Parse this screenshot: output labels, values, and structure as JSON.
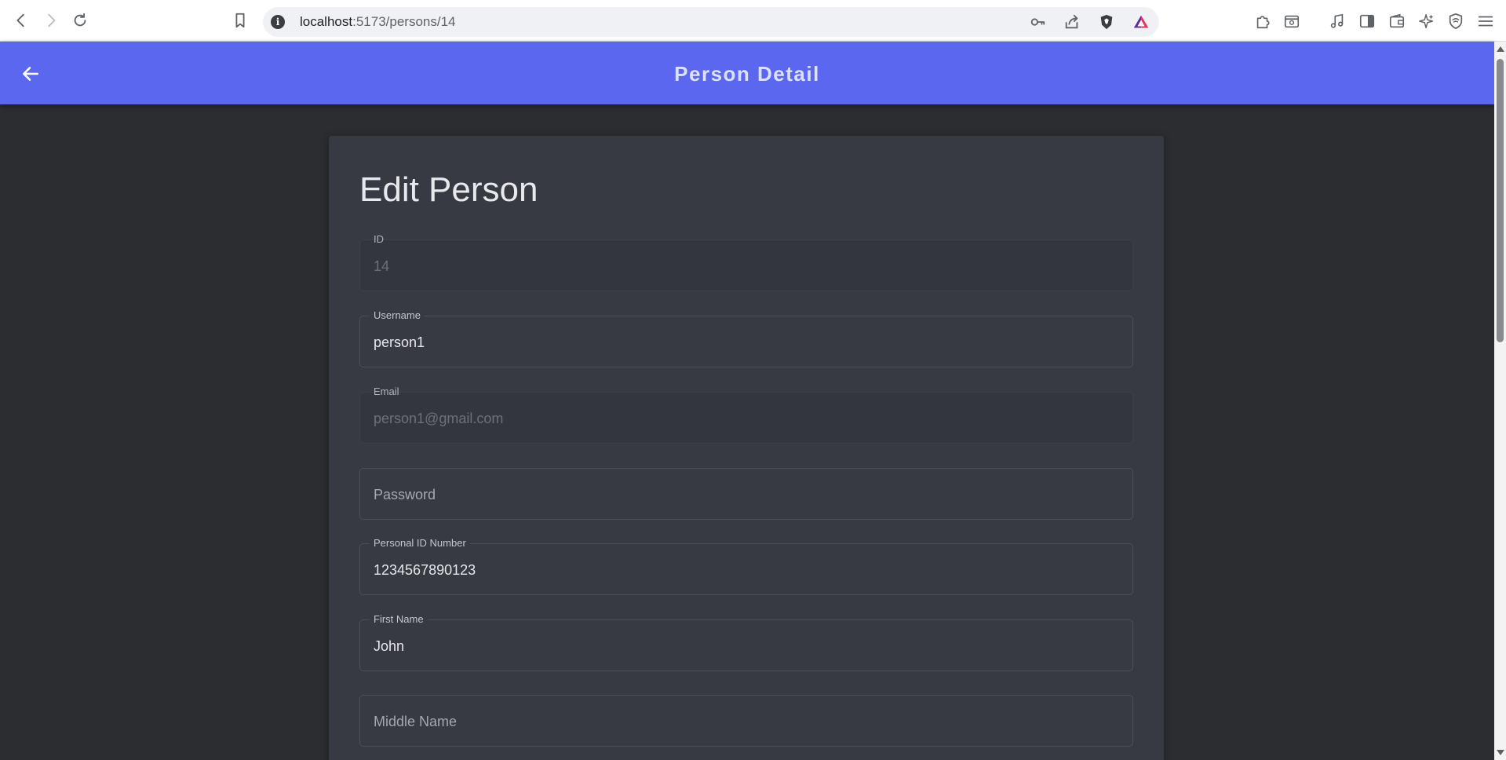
{
  "browser": {
    "url_host": "localhost",
    "url_path": ":5173/persons/14",
    "icons": [
      "back-arrow-icon",
      "forward-arrow-icon",
      "reload-icon",
      "bookmark-icon",
      "site-info-icon",
      "key-icon",
      "share-icon",
      "brave-shield-icon",
      "brave-rewards-icon",
      "extensions-icon",
      "tab-search-icon",
      "music-icon",
      "sidebar-icon",
      "wallet-icon",
      "leo-ai-icon",
      "vpn-icon",
      "menu-icon"
    ]
  },
  "app_bar": {
    "title": "Person Detail",
    "accent_color": "#5b67ee"
  },
  "form": {
    "heading": "Edit Person",
    "fields": [
      {
        "key": "id",
        "label": "ID",
        "value": "14",
        "disabled": true
      },
      {
        "key": "username",
        "label": "Username",
        "value": "person1",
        "disabled": false
      },
      {
        "key": "email",
        "label": "Email",
        "value": "person1@gmail.com",
        "disabled": true
      },
      {
        "key": "password",
        "placeholder": "Password",
        "value": "",
        "disabled": false
      },
      {
        "key": "personal_id",
        "label": "Personal ID Number",
        "value": "1234567890123",
        "disabled": false
      },
      {
        "key": "first_name",
        "label": "First Name",
        "value": "John",
        "disabled": false
      },
      {
        "key": "middle_name",
        "placeholder": "Middle Name",
        "value": "",
        "disabled": false
      }
    ]
  }
}
